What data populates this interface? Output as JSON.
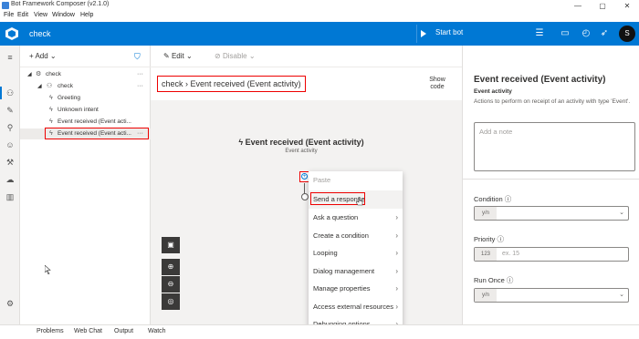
{
  "window": {
    "title": "Bot Framework Composer (v2.1.0)",
    "controls": [
      "—",
      "▢",
      "✕"
    ]
  },
  "menu": [
    "File",
    "Edit",
    "View",
    "Window",
    "Help"
  ],
  "header": {
    "bot_name": "check",
    "start_bot": "Start bot",
    "avatar_initial": "S",
    "bg_color": "#0078d4"
  },
  "tree": {
    "add_label": "Add",
    "items": [
      {
        "label": "check",
        "level": 0,
        "icon": "bot-icon",
        "more": "···"
      },
      {
        "label": "check",
        "level": 1,
        "icon": "dialog-icon",
        "more": "···"
      },
      {
        "label": "Greeting",
        "level": 2,
        "icon": "trigger-icon"
      },
      {
        "label": "Unknown intent",
        "level": 2,
        "icon": "trigger-icon"
      },
      {
        "label": "Event received (Event acti...",
        "level": 2,
        "icon": "trigger-icon"
      },
      {
        "label": "Event received (Event acti...",
        "level": 2,
        "icon": "trigger-icon",
        "more": "···",
        "selected": true
      }
    ]
  },
  "canvas_toolbar": {
    "edit": "Edit",
    "disable": "Disable"
  },
  "breadcrumb": {
    "root": "check",
    "separator": ">",
    "current": "Event received (Event activity)"
  },
  "show_code": "Show code",
  "node": {
    "title": "Event received (Event activity)",
    "subtitle": "Event activity"
  },
  "context_menu": {
    "items": [
      {
        "label": "Paste",
        "disabled": true,
        "submenu": false
      },
      {
        "label": "Send a response",
        "disabled": false,
        "submenu": false,
        "highlight": true
      },
      {
        "label": "Ask a question",
        "disabled": false,
        "submenu": true
      },
      {
        "label": "Create a condition",
        "disabled": false,
        "submenu": true
      },
      {
        "label": "Looping",
        "disabled": false,
        "submenu": true
      },
      {
        "label": "Dialog management",
        "disabled": false,
        "submenu": true
      },
      {
        "label": "Manage properties",
        "disabled": false,
        "submenu": true
      },
      {
        "label": "Access external resources",
        "disabled": false,
        "submenu": true
      },
      {
        "label": "Debugging options",
        "disabled": false,
        "submenu": true
      }
    ]
  },
  "properties": {
    "title": "Event received (Event activity)",
    "subtitle": "Event activity",
    "description": "Actions to perform on receipt of an activity with type 'Event'.",
    "note_placeholder": "Add a note",
    "condition_label": "Condition",
    "condition_type": "y/n",
    "priority_label": "Priority",
    "priority_type": "123",
    "priority_placeholder": "ex. 15",
    "run_once_label": "Run Once",
    "run_once_type": "y/n"
  },
  "bottom_tabs": [
    "Problems",
    "Web Chat",
    "Output",
    "Watch"
  ]
}
